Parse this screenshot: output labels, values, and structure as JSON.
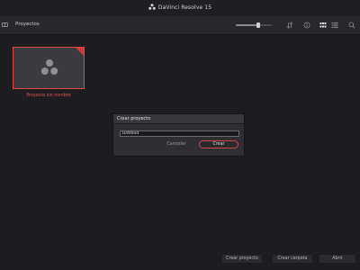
{
  "app": {
    "title": "DaVinci Resolve 15"
  },
  "toolbar": {
    "title": "Proyectos",
    "zoom_level": 0.63,
    "icons": [
      "sidebar-icon",
      "zoom-slider",
      "sort-icon",
      "info-icon",
      "grid-view-icon",
      "list-view-icon",
      "search-icon"
    ]
  },
  "project": {
    "name": "Proyecto sin nombre",
    "selected": true
  },
  "dialog": {
    "title": "Crear proyecto",
    "name_value": "Untitled",
    "cancel_label": "Cancelar",
    "create_label": "Crear"
  },
  "footer": {
    "new_project_label": "Crear proyecto",
    "new_folder_label": "Crear carpeta",
    "open_label": "Abrir"
  },
  "colors": {
    "accent": "#e04848",
    "background": "#1d1d21",
    "panel": "#2e2e33"
  }
}
